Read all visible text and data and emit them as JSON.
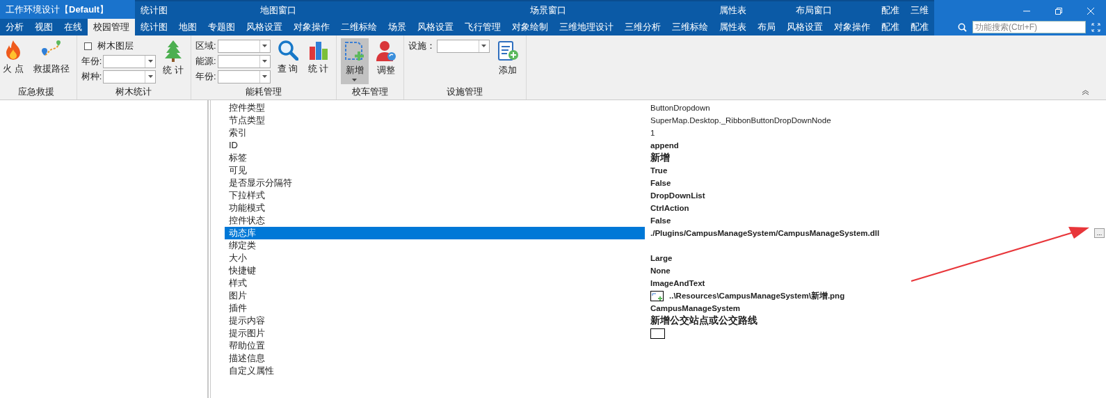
{
  "window": {
    "title": "工作环境设计【**Default**】"
  },
  "base_tabs": [
    {
      "label": "分析",
      "selected": false
    },
    {
      "label": "视图",
      "selected": false
    },
    {
      "label": "在线",
      "selected": false
    },
    {
      "label": "校园管理",
      "selected": true
    }
  ],
  "context_groups": [
    {
      "label": "统计图",
      "tabs": [
        {
          "label": "统计图",
          "selected": false
        }
      ]
    },
    {
      "label": "地图窗口",
      "tabs": [
        {
          "label": "地图",
          "selected": false
        },
        {
          "label": "专题图",
          "selected": false
        },
        {
          "label": "风格设置",
          "selected": false
        },
        {
          "label": "对象操作",
          "selected": false
        },
        {
          "label": "二维标绘",
          "selected": false
        }
      ]
    },
    {
      "label": "场景窗口",
      "tabs": [
        {
          "label": "场景",
          "selected": false
        },
        {
          "label": "风格设置",
          "selected": false
        },
        {
          "label": "飞行管理",
          "selected": false
        },
        {
          "label": "对象绘制",
          "selected": false
        },
        {
          "label": "三维地理设计",
          "selected": false
        },
        {
          "label": "三维分析",
          "selected": false
        },
        {
          "label": "三维标绘",
          "selected": false
        }
      ]
    },
    {
      "label": "属性表",
      "tabs": [
        {
          "label": "属性表",
          "selected": false
        }
      ]
    },
    {
      "label": "布局窗口",
      "tabs": [
        {
          "label": "布局",
          "selected": false
        },
        {
          "label": "风格设置",
          "selected": false
        },
        {
          "label": "对象操作",
          "selected": false
        }
      ]
    },
    {
      "label": "配准",
      "tabs": [
        {
          "label": "配准",
          "selected": false
        }
      ]
    },
    {
      "label": "三维",
      "tabs": [
        {
          "label": "配准",
          "selected": false
        }
      ]
    }
  ],
  "search": {
    "placeholder": "功能搜索(Ctrl+F)"
  },
  "ribbon_groups": [
    {
      "label": "应急救援",
      "items": [
        {
          "kind": "large",
          "label": "火 点",
          "pressed": false
        },
        {
          "kind": "large",
          "label": "救援路径",
          "pressed": false
        }
      ]
    },
    {
      "label": "树木统计",
      "items": [
        {
          "kind": "stack",
          "items": [
            {
              "kind": "checkbox",
              "label": "树木图层",
              "checked": false
            },
            {
              "kind": "combo",
              "label": "年份:"
            },
            {
              "kind": "combo",
              "label": "树种:"
            }
          ]
        },
        {
          "kind": "large",
          "label": "统 计",
          "pressed": false
        }
      ]
    },
    {
      "label": "能耗管理",
      "items": [
        {
          "kind": "stack",
          "items": [
            {
              "kind": "combo",
              "label": "区域:"
            },
            {
              "kind": "combo",
              "label": "能源:"
            },
            {
              "kind": "combo",
              "label": "年份:"
            }
          ]
        },
        {
          "kind": "large",
          "label": "查 询",
          "pressed": false
        },
        {
          "kind": "large",
          "label": "统 计",
          "pressed": false
        }
      ]
    },
    {
      "label": "校车管理",
      "items": [
        {
          "kind": "split",
          "label": "新增",
          "pressed": true
        },
        {
          "kind": "large",
          "label": "调整",
          "pressed": false
        }
      ]
    },
    {
      "label": "设施管理",
      "items": [
        {
          "kind": "stack",
          "items": [
            {
              "kind": "combo",
              "label": "设施："
            }
          ]
        },
        {
          "kind": "large",
          "label": "添加",
          "pressed": false
        }
      ]
    }
  ],
  "properties": [
    {
      "name": "控件类型",
      "kind": "plain",
      "value": "ButtonDropdown",
      "selected": false
    },
    {
      "name": "节点类型",
      "kind": "plain",
      "value": "SuperMap.Desktop._RibbonButtonDropDownNode",
      "selected": false
    },
    {
      "name": "索引",
      "kind": "plain",
      "value": "1",
      "selected": false
    },
    {
      "name": "ID",
      "kind": "bold",
      "value": "append",
      "selected": false
    },
    {
      "name": "标签",
      "kind": "heading",
      "value": "新增",
      "selected": false
    },
    {
      "name": "可见",
      "kind": "bold",
      "value": "True",
      "selected": false
    },
    {
      "name": "是否显示分隔符",
      "kind": "bold",
      "value": "False",
      "selected": false
    },
    {
      "name": "下拉样式",
      "kind": "bold",
      "value": "DropDownList",
      "selected": false
    },
    {
      "name": "功能模式",
      "kind": "bold",
      "value": "CtrlAction",
      "selected": false
    },
    {
      "name": "控件状态",
      "kind": "bold",
      "value": "False",
      "selected": false
    },
    {
      "name": "动态库",
      "kind": "bold",
      "value": "./Plugins/CampusManageSystem/CampusManageSystem.dll",
      "selected": true,
      "button": "..."
    },
    {
      "name": "绑定类",
      "kind": "empty",
      "selected": false
    },
    {
      "name": "大小",
      "kind": "bold",
      "value": "Large",
      "selected": false
    },
    {
      "name": "快捷键",
      "kind": "bold",
      "value": "None",
      "selected": false
    },
    {
      "name": "样式",
      "kind": "bold",
      "value": "ImageAndText",
      "selected": false
    },
    {
      "name": "图片",
      "kind": "image",
      "value": "..\\Resources\\CampusManageSystem\\新增.png",
      "selected": false
    },
    {
      "name": "插件",
      "kind": "bold",
      "value": "CampusManageSystem",
      "selected": false
    },
    {
      "name": "提示内容",
      "kind": "heading",
      "value": "新增公交站点或公交路线",
      "selected": false
    },
    {
      "name": "提示图片",
      "kind": "swatch",
      "selected": false
    },
    {
      "name": "帮助位置",
      "kind": "empty",
      "selected": false
    },
    {
      "name": "描述信息",
      "kind": "empty",
      "selected": false
    },
    {
      "name": "自定义属性",
      "kind": "empty",
      "selected": false
    }
  ]
}
